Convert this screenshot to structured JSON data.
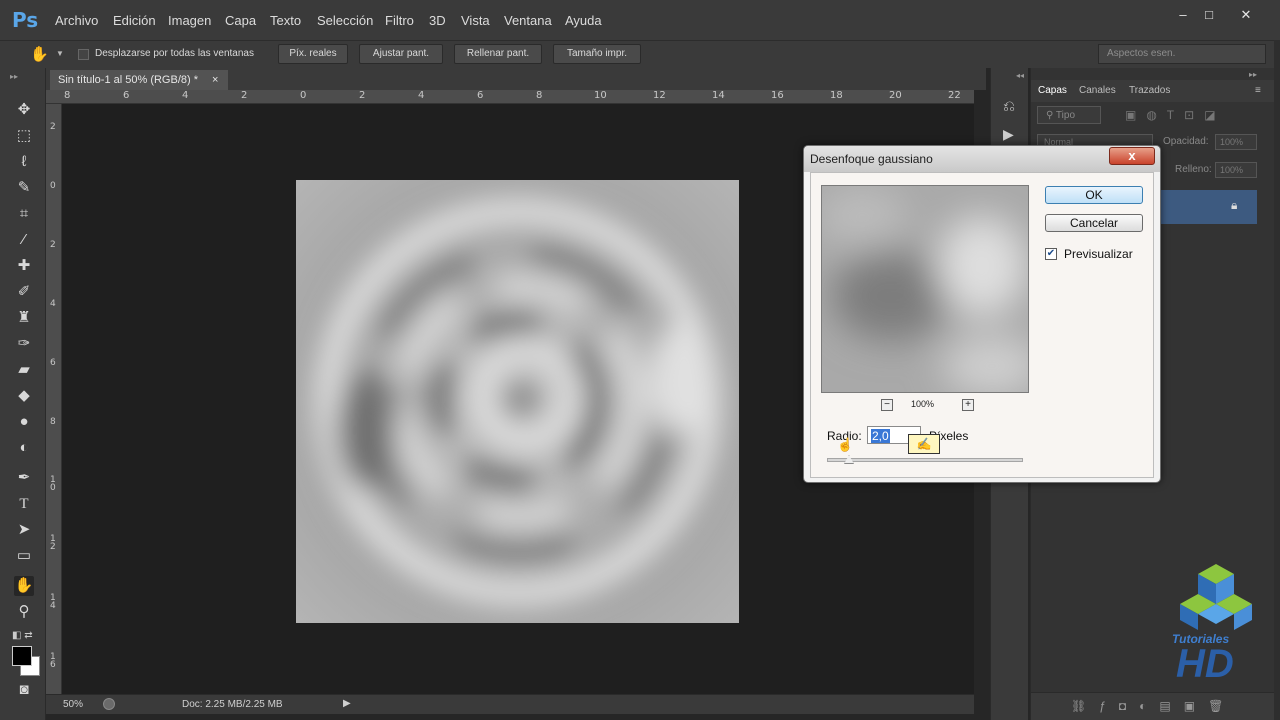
{
  "app": {
    "logo": "Ps"
  },
  "menu": [
    "Archivo",
    "Edición",
    "Imagen",
    "Capa",
    "Texto",
    "Selección",
    "Filtro",
    "3D",
    "Vista",
    "Ventana",
    "Ayuda"
  ],
  "options_bar": {
    "scroll_all_label": "Desplazarse por todas las ventanas",
    "buttons": [
      "Píx. reales",
      "Ajustar pant.",
      "Rellenar pant.",
      "Tamaño impr."
    ],
    "workspace": "Aspectos esen."
  },
  "document_tab": {
    "title": "Sin título-1 al 50% (RGB/8) *",
    "close": "×"
  },
  "ruler_top": [
    "8",
    "6",
    "4",
    "2",
    "0",
    "2",
    "4",
    "6",
    "8",
    "10",
    "12",
    "14",
    "16",
    "18",
    "20",
    "22"
  ],
  "ruler_left": [
    "2",
    "0",
    "2",
    "4",
    "6",
    "8",
    "1\n0",
    "1\n2",
    "1\n4",
    "1\n6"
  ],
  "status": {
    "zoom": "50%",
    "doc": "Doc: 2.25 MB/2.25 MB"
  },
  "layers_panel": {
    "tabs": [
      "Capas",
      "Canales",
      "Trazados"
    ],
    "filter": "Tipo",
    "blend_mode": "Normal",
    "opacity_label": "Opacidad:",
    "opacity_value": "100%",
    "fill_label": "Relleno:",
    "fill_value": "100%"
  },
  "dialog": {
    "title": "Desenfoque gaussiano",
    "close": "x",
    "ok": "OK",
    "cancel": "Cancelar",
    "preview_label": "Previsualizar",
    "preview_checked": true,
    "zoom_minus": "−",
    "zoom_plus": "+",
    "zoom": "100%",
    "radius_label": "Radio:",
    "radius_value": "2,0",
    "radius_unit": "Píxeles"
  },
  "watermark": {
    "line1": "Tutoriales",
    "line2": "HD"
  },
  "colors": {
    "accent": "#5aa6e8",
    "selected_layer": "#3d5a80",
    "ok_border": "#3c7fb1"
  }
}
